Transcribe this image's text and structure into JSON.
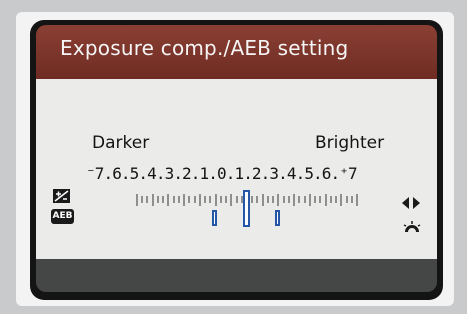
{
  "screen": {
    "title": "Exposure comp./AEB setting",
    "darker_label": "Darker",
    "brighter_label": "Brighter",
    "scale_text": "⁻7.6.5.4.3.2.1.0.1.2.3.4.5.6.⁺7",
    "aeb_badge": "AEB",
    "exposure_value": 0,
    "aeb_bracket": [
      -2,
      2
    ],
    "icons": [
      "exposure-compensation-icon",
      "aeb-icon",
      "left-right-arrows-icon",
      "main-dial-icon"
    ]
  },
  "colors": {
    "header": "#7a3429",
    "body": "#ebebe9",
    "marker_border": "#2557a8",
    "bottom_bar": "#454646"
  }
}
